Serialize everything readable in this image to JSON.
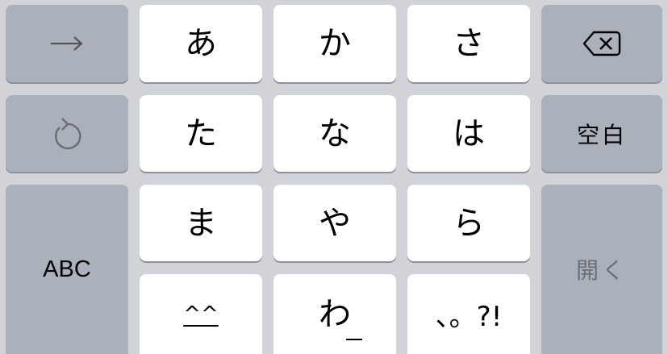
{
  "keyboard": {
    "row0": {
      "arrow_key": {
        "icon": "right-arrow-icon"
      },
      "a": "あ",
      "ka": "か",
      "sa": "さ",
      "delete_key": {
        "icon": "backspace-icon"
      }
    },
    "row1": {
      "undo_key": {
        "icon": "undo-icon"
      },
      "ta": "た",
      "na": "な",
      "ha": "は",
      "space": "空白"
    },
    "row2": {
      "abc": "ABC",
      "ma": "ま",
      "ya": "や",
      "ra": "ら",
      "open": "開く"
    },
    "row3": {
      "face": "^^",
      "wa": "わ",
      "punct": "、。?!"
    }
  },
  "colors": {
    "background": "#d1d3d9",
    "light_key": "#ffffff",
    "dark_key": "#abb1bb",
    "key_shadow": "#8e9097",
    "disabled_text": "#6b6e74"
  }
}
